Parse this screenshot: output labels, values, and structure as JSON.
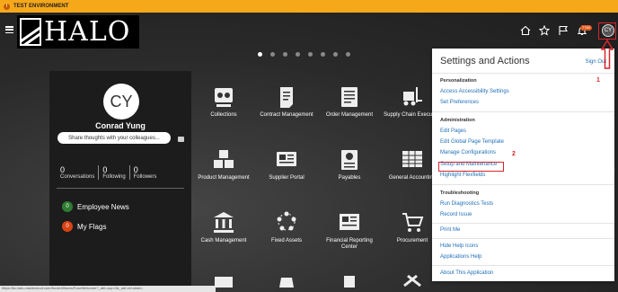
{
  "env": {
    "label": "TEST ENVIRONMENT",
    "icon": "alert-icon"
  },
  "logo": {
    "text": "HALO"
  },
  "header": {
    "icons": [
      "home-icon",
      "star-icon",
      "flag-icon",
      "bell-icon"
    ],
    "notification_count": "7789",
    "user_initials": "CY"
  },
  "carousel": {
    "count": 8,
    "active": 0
  },
  "profile": {
    "initials": "CY",
    "name": "Conrad Yung",
    "share_placeholder": "Share thoughts with your colleagues...",
    "stats": [
      {
        "value": "0",
        "label": "Conversations"
      },
      {
        "value": "0",
        "label": "Following"
      },
      {
        "value": "0",
        "label": "Followers"
      }
    ],
    "news": [
      {
        "count": "0",
        "label": "Employee News",
        "color": "#2e7d32"
      },
      {
        "count": "0",
        "label": "My Flags",
        "color": "#d84315"
      }
    ]
  },
  "tiles": [
    {
      "label": "Collections",
      "icon": "collections-icon"
    },
    {
      "label": "Contract Management",
      "icon": "contract-icon"
    },
    {
      "label": "Order Management",
      "icon": "order-icon"
    },
    {
      "label": "Supply Chain Execution",
      "icon": "forklift-icon"
    },
    {
      "label": "Product Management",
      "icon": "boxes-icon"
    },
    {
      "label": "Supplier Portal",
      "icon": "portal-icon"
    },
    {
      "label": "Payables",
      "icon": "payables-icon"
    },
    {
      "label": "General Accounting",
      "icon": "ledger-icon"
    },
    {
      "label": "Cash Management",
      "icon": "bank-icon"
    },
    {
      "label": "Fixed Assets",
      "icon": "assets-icon"
    },
    {
      "label": "Financial Reporting Center",
      "icon": "report-icon"
    },
    {
      "label": "Procurement",
      "icon": "cart-icon"
    }
  ],
  "panel": {
    "title": "Settings and Actions",
    "sign_out": "Sign Out",
    "sections": [
      {
        "heading": "Personalization",
        "links": [
          "Access Accessibility Settings",
          "Set Preferences"
        ]
      },
      {
        "heading": "Administration",
        "links": [
          "Edit Pages",
          "Edit Global Page Template",
          "Manage Configurations",
          "Setup and Maintenance",
          "Highlight Flexfields"
        ]
      },
      {
        "heading": "Troubleshooting",
        "links": [
          "Run Diagnostics Tests",
          "Record Issue"
        ]
      },
      {
        "heading": "",
        "links": [
          "Print Me"
        ]
      },
      {
        "heading": "",
        "links": [
          "Hide Help Icons",
          "Applications Help"
        ]
      },
      {
        "heading": "",
        "links": [
          "About This Application"
        ]
      }
    ]
  },
  "annotations": {
    "step1": "1",
    "step2": "2"
  },
  "status_bar": {
    "text": "https://fa-halo.oraclecloud.com/fscmUI/faces/FuseWelcome?_afrLoop=0&_adf.ctrl-state="
  }
}
